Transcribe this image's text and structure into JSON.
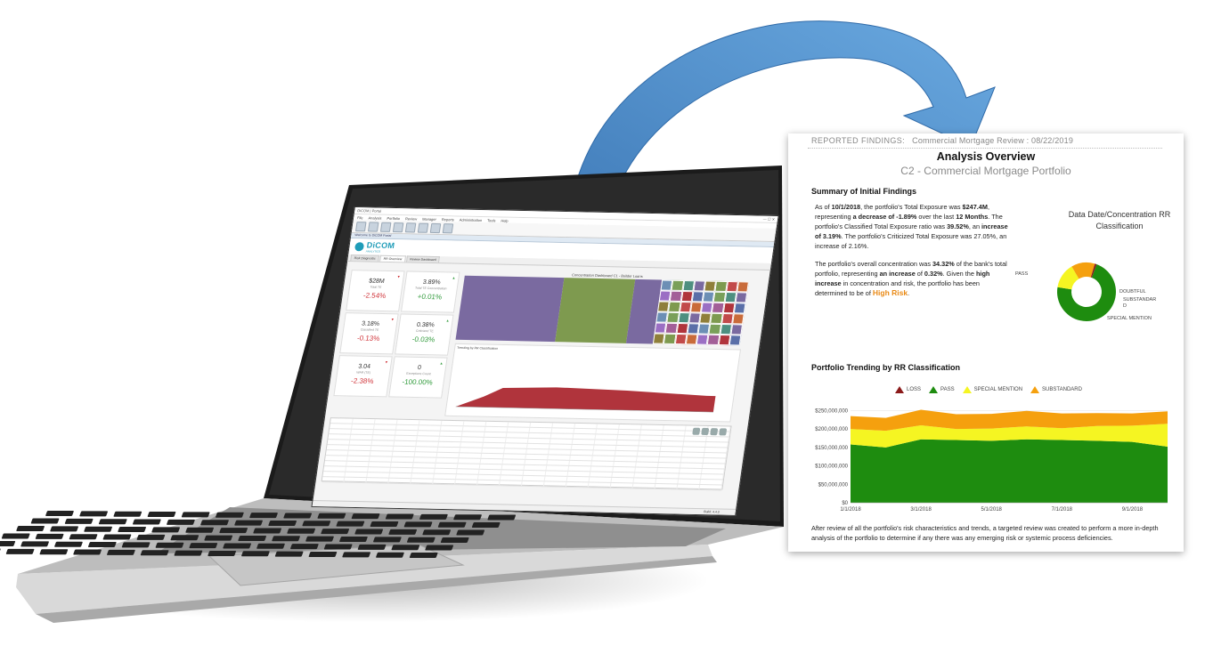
{
  "laptop_app": {
    "title_bar": "DiCOM | Portal",
    "menu": [
      "File",
      "Analysis",
      "Portfolio",
      "Review",
      "Manager",
      "Reports",
      "Administration",
      "Tools",
      "Help"
    ],
    "welcome": "Welcome to DiCOM Portal",
    "brand": "DiCOM",
    "brand_sub": "ANALYTICS",
    "tabs": [
      "Risk Diagnostic",
      "RR Overview",
      "Review Dashboard"
    ],
    "treemap_title": "Concentration Dashboard C1 - Builder Loans",
    "trend_title": "Trending by RR Classification",
    "status_text": "Build: 4.4.0",
    "kpis": [
      {
        "value": "$28M",
        "label": "Total TE",
        "change": "-2.54%",
        "dir": "neg"
      },
      {
        "value": "3.89%",
        "label": "Total TE Concentration",
        "change": "+0.01%",
        "dir": "pos"
      },
      {
        "value": "3.18%",
        "label": "Classified TE",
        "change": "-0.13%",
        "dir": "neg"
      },
      {
        "value": "0.38%",
        "label": "Criticized TE",
        "change": "-0.03%",
        "dir": "pos"
      },
      {
        "value": "3.04",
        "label": "WAR (TE)",
        "change": "-2.38%",
        "dir": "neg"
      },
      {
        "value": "0",
        "label": "Exceptions Count",
        "change": "-100.00%",
        "dir": "pos"
      }
    ]
  },
  "report": {
    "header_label": "REPORTED FINDINGS:",
    "header_value": "Commercial Mortgage Review : 08/22/2019",
    "title": "Analysis Overview",
    "subtitle": "C2 - Commercial Mortgage Portfolio",
    "summary_heading": "Summary of Initial Findings",
    "summary_p1": {
      "a": "As of ",
      "date": "10/1/2018",
      "b": ", the portfolio's Total Exposure was ",
      "te": "$247.4M",
      "c": ", representing ",
      "dec": "a decrease of -1.89%",
      "d": " over the last ",
      "months": "12 Months",
      "e": ".  The portfolio's Classified Total Exposure ratio was ",
      "cls": "39.52%",
      "f": ", an ",
      "inc1": "increase of 3.19%",
      "g": ".  The portfolio's Criticized Total Exposure was 27.05%, an increase of 2.16%."
    },
    "summary_p2": {
      "a": "The portfolio's overall concentration was ",
      "conc": "34.32%",
      "b": " of the bank's total portfolio, representing ",
      "inc": "an increase",
      "c": " of ",
      "incv": "0.32%",
      "d": ".  Given the ",
      "hi": "high increase",
      "e": " in concentration and risk, the portfolio has been determined to be of ",
      "risk": "High Risk",
      "f": "."
    },
    "donut_title": "Data Date/Concentration RR Classification",
    "donut_labels": {
      "pass": "PASS",
      "doubtful": "DOUBTFUL",
      "substandard": "SUBSTANDAR D",
      "special": "SPECIAL MENTION"
    },
    "trend_heading": "Portfolio Trending by RR Classification",
    "footer": "After review of all the portfolio's risk characteristics and trends, a targeted review was created to perform a more in-depth analysis of the portfolio to determine if any there was any emerging risk or systemic process deficiencies."
  },
  "colors": {
    "loss": "#8b1a1a",
    "pass": "#1e8c0f",
    "special_mention": "#f5f522",
    "substandard": "#f5a00e",
    "arrow": "#4a8fd0"
  },
  "chart_data": [
    {
      "type": "pie",
      "title": "Data Date/Concentration RR Classification",
      "categories": [
        "PASS",
        "SPECIAL MENTION",
        "SUBSTANDARD",
        "DOUBTFUL"
      ],
      "values": [
        72,
        14,
        13,
        1
      ]
    },
    {
      "type": "area",
      "title": "Portfolio Trending by RR Classification",
      "x": [
        "1/1/2018",
        "2/1/2018",
        "3/1/2018",
        "4/1/2018",
        "5/1/2018",
        "6/1/2018",
        "7/1/2018",
        "8/1/2018",
        "9/1/2018",
        "10/1/2018"
      ],
      "x_ticks": [
        "1/1/2018",
        "3/1/2018",
        "5/1/2018",
        "7/1/2018",
        "9/1/2018"
      ],
      "y_ticks": [
        "$0",
        "$50,000,000",
        "$100,000,000",
        "$150,000,000",
        "$200,000,000",
        "$250,000,000"
      ],
      "ylim": [
        0,
        275000000
      ],
      "stacked": true,
      "series": [
        {
          "name": "LOSS",
          "values": [
            0,
            0,
            0,
            0,
            0,
            0,
            0,
            0,
            0,
            0
          ]
        },
        {
          "name": "PASS",
          "values": [
            158000000,
            150000000,
            172000000,
            170000000,
            168000000,
            172000000,
            170000000,
            168000000,
            165000000,
            152000000
          ]
        },
        {
          "name": "SPECIAL MENTION",
          "values": [
            42000000,
            45000000,
            38000000,
            30000000,
            33000000,
            35000000,
            32000000,
            40000000,
            44000000,
            62000000
          ]
        },
        {
          "name": "SUBSTANDARD",
          "values": [
            35000000,
            35000000,
            42000000,
            40000000,
            40000000,
            42000000,
            40000000,
            35000000,
            33000000,
            34000000
          ]
        }
      ]
    }
  ]
}
